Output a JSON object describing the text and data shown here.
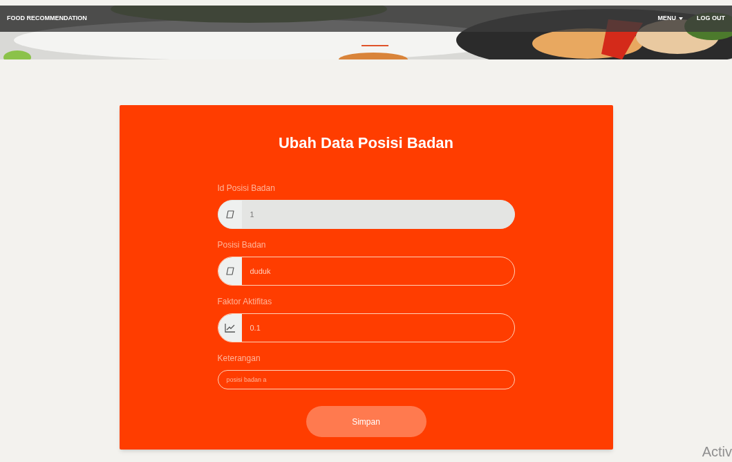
{
  "navbar": {
    "brand": "FOOD RECOMMENDATION",
    "menu": "MENU",
    "logout": "LOG OUT"
  },
  "form": {
    "title": "Ubah Data Posisi Badan",
    "fields": [
      {
        "label": "Id Posisi Badan",
        "kind": "shape",
        "value": "1",
        "disabled": true
      },
      {
        "label": "Posisi Badan",
        "kind": "shape",
        "value": "duduk",
        "disabled": false
      },
      {
        "label": "Faktor Aktifitas",
        "kind": "chart",
        "value": "0.1",
        "disabled": false
      },
      {
        "label": "Keterangan",
        "kind": "plain",
        "value": "posisi badan a",
        "disabled": false
      }
    ],
    "submit": "Simpan"
  },
  "os_notice": "Activ"
}
